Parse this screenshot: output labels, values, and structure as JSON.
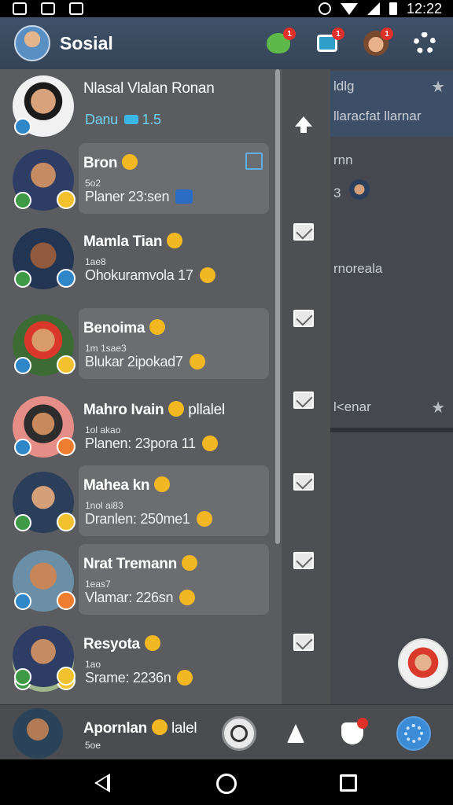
{
  "status_bar": {
    "time": "12:22"
  },
  "app_bar": {
    "title": "Sosial",
    "badges": {
      "frog": "1",
      "chat": "1",
      "profile": "1"
    }
  },
  "background": {
    "lines": [
      "ldlg",
      "llaracfat llarnar",
      "rnn",
      "3",
      "rnoreala",
      "l<enar"
    ]
  },
  "drawer": {
    "profile": {
      "name": "Nlasal Vlalan Ronan",
      "subtitle": "Danu",
      "subtitle_suffix": "1.5"
    },
    "contacts": [
      {
        "name": "Bron",
        "meta": "5o2",
        "status": "Planer 23:sen"
      },
      {
        "name": "Mamla Tian",
        "meta": "1ae8",
        "status": "Ohokuramvola 17"
      },
      {
        "name": "Benoima",
        "meta": "1m 1sae3",
        "status": "Blukar 2ipokad7"
      },
      {
        "name": "Mahro Ivain",
        "name_suffix": "pllalel",
        "meta": "1ol akao",
        "status": "Planen: 23pora 11"
      },
      {
        "name": "Mahea kn",
        "meta": "1nol ai83",
        "status": "Dranlen: 250me1"
      },
      {
        "name": "Nrat Tremann",
        "meta": "1eas7",
        "status": "Vlamar: 226sn"
      },
      {
        "name": "Resyota",
        "meta": "1ao",
        "status": "Srame: 2236n"
      },
      {
        "name": "Apornlan",
        "name_suffix": "lalel",
        "meta": "5oe"
      }
    ]
  }
}
